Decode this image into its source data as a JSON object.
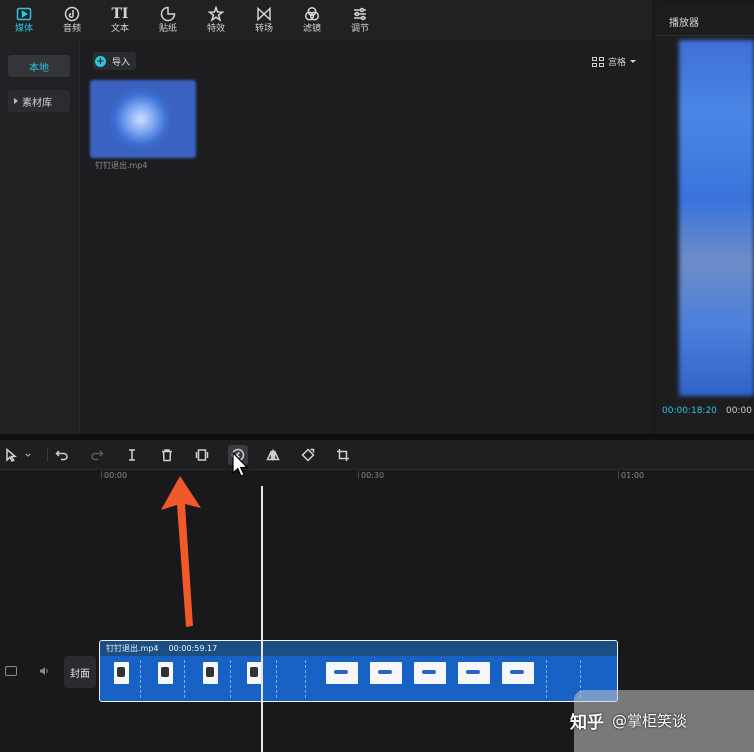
{
  "toolbar": {
    "tabs": [
      {
        "label": "媒体",
        "icon": "media-icon"
      },
      {
        "label": "音频",
        "icon": "audio-icon"
      },
      {
        "label": "文本",
        "icon": "text-icon"
      },
      {
        "label": "贴纸",
        "icon": "sticker-icon"
      },
      {
        "label": "特效",
        "icon": "effects-icon"
      },
      {
        "label": "转场",
        "icon": "transition-icon"
      },
      {
        "label": "滤镜",
        "icon": "filter-icon"
      },
      {
        "label": "调节",
        "icon": "adjust-icon"
      }
    ],
    "text_glyph": "TI",
    "active_color": "#2ec5e2"
  },
  "sidebar": {
    "local_label": "本地",
    "library_label": "素材库"
  },
  "media": {
    "import_label": "导入",
    "plus": "+",
    "view_label": "宫格",
    "file_name": "钉钉退出.mp4"
  },
  "player": {
    "title": "播放器",
    "current_time": "00:00:18:20",
    "total_time": "00:00"
  },
  "timeline_toolbar": {
    "tooltip": "倒放"
  },
  "ruler": {
    "labels": [
      "00:00",
      "00:30",
      "01:00"
    ]
  },
  "track": {
    "cover_label": "封面",
    "clip_name": "钉钉退出.mp4",
    "clip_duration": "00:00:59.17"
  },
  "watermark": {
    "site": "知乎",
    "author": "@掌柜笑谈"
  }
}
